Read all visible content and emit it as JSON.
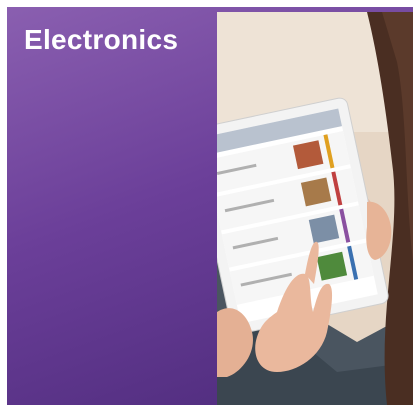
{
  "tile": {
    "title": "Electronics",
    "image_icon": "tablet-photo"
  },
  "colors": {
    "tile_gradient_start": "#8a5fb0",
    "tile_gradient_end": "#4c2a7a",
    "title_text": "#ffffff"
  }
}
